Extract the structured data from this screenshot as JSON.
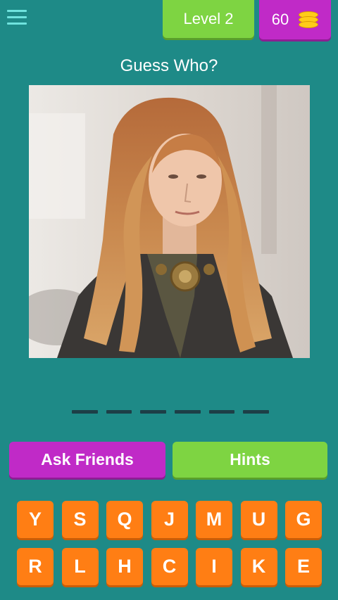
{
  "header": {
    "level_label": "Level 2",
    "coins": "60",
    "menu_icon": "hamburger-menu-icon",
    "coin_icon": "coin-stack-icon"
  },
  "question": {
    "title": "Guess Who?"
  },
  "answer": {
    "slot_count": 6
  },
  "buttons": {
    "ask_friends": "Ask Friends",
    "hints": "Hints"
  },
  "keyboard": {
    "row1": [
      "Y",
      "S",
      "Q",
      "J",
      "M",
      "U",
      "G"
    ],
    "row2": [
      "R",
      "L",
      "H",
      "C",
      "I",
      "K",
      "E"
    ]
  },
  "colors": {
    "background": "#1e8a87",
    "green": "#7ed442",
    "purple": "#c02ac7",
    "orange": "#ff7e14"
  }
}
